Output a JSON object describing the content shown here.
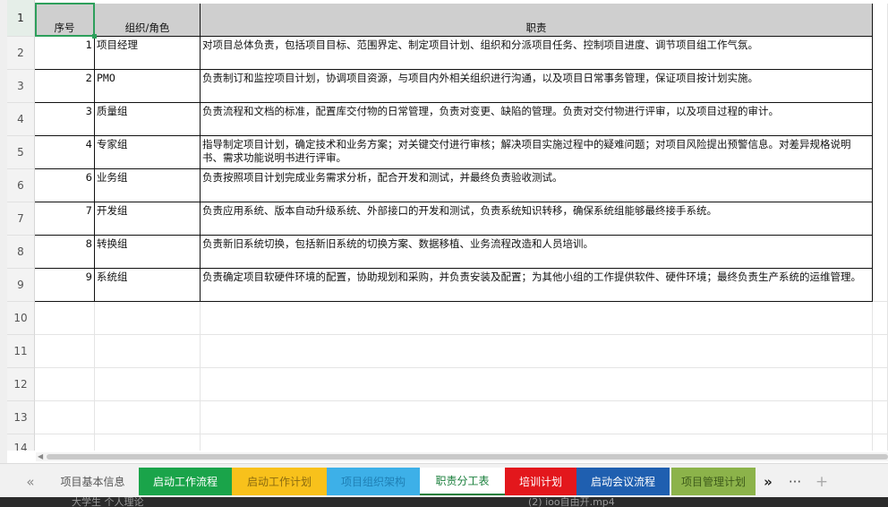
{
  "header": {
    "col_a": "序号",
    "col_b": "组织/角色",
    "col_c": "职责"
  },
  "row_numbers": [
    "1",
    "2",
    "3",
    "4",
    "5",
    "6",
    "7",
    "8",
    "9",
    "10",
    "11",
    "12",
    "13",
    "14"
  ],
  "rows": [
    {
      "no": "1",
      "role": "项目经理",
      "duty": "对项目总体负责，包括项目目标、范围界定、制定项目计划、组织和分派项目任务、控制项目进度、调节项目组工作气氛。"
    },
    {
      "no": "2",
      "role": "PMO",
      "duty": "负责制订和监控项目计划，协调项目资源，与项目内外相关组织进行沟通，以及项目日常事务管理，保证项目按计划实施。"
    },
    {
      "no": "3",
      "role": "质量组",
      "duty": "负责流程和文档的标准，配置库交付物的日常管理，负责对变更、缺陷的管理。负责对交付物进行评审，以及项目过程的审计。"
    },
    {
      "no": "4",
      "role": "专家组",
      "duty": "指导制定项目计划，确定技术和业务方案；对关键交付进行审核；解决项目实施过程中的疑难问题；对项目风险提出预警信息。对差异规格说明书、需求功能说明书进行评审。"
    },
    {
      "no": "6",
      "role": "业务组",
      "duty": "负责按照项目计划完成业务需求分析，配合开发和测试，并最终负责验收测试。"
    },
    {
      "no": "7",
      "role": "开发组",
      "duty": "负责应用系统、版本自动升级系统、外部接口的开发和测试，负责系统知识转移，确保系统组能够最终接手系统。"
    },
    {
      "no": "8",
      "role": "转换组",
      "duty": "负责新旧系统切换，包括新旧系统的切换方案、数据移植、业务流程改造和人员培训。"
    },
    {
      "no": "9",
      "role": "系统组",
      "duty": "负责确定项目软硬件环境的配置，协助规划和采购，并负责安装及配置；为其他小组的工作提供软件、硬件环境；最终负责生产系统的运维管理。"
    }
  ],
  "tabs": [
    {
      "label": "项目基本信息",
      "bg": "#f1f1f1",
      "fg": "#555555"
    },
    {
      "label": "启动工作流程",
      "bg": "#1aa44a",
      "fg": "#ffffff"
    },
    {
      "label": "启动工作计划",
      "bg": "#f8c11b",
      "fg": "#8a6a10"
    },
    {
      "label": "项目组织架构",
      "bg": "#3db0e8",
      "fg": "#1f7fb4"
    },
    {
      "label": "职责分工表",
      "bg": "#ffffff",
      "fg": "#1a7f3c"
    },
    {
      "label": "培训计划",
      "bg": "#e3171c",
      "fg": "#ffffff"
    },
    {
      "label": "启动会议流程",
      "bg": "#1f5fb0",
      "fg": "#ffffff"
    },
    {
      "label": "项目管理计划",
      "bg": "#8cb34a",
      "fg": "#3d5a1a"
    }
  ],
  "tab_nav": {
    "prev": "«",
    "next": "»",
    "more": "···",
    "add": "+"
  },
  "background_strip": {
    "left": "大学生 个人理论",
    "right": "(2) ioo自由开.mp4"
  }
}
